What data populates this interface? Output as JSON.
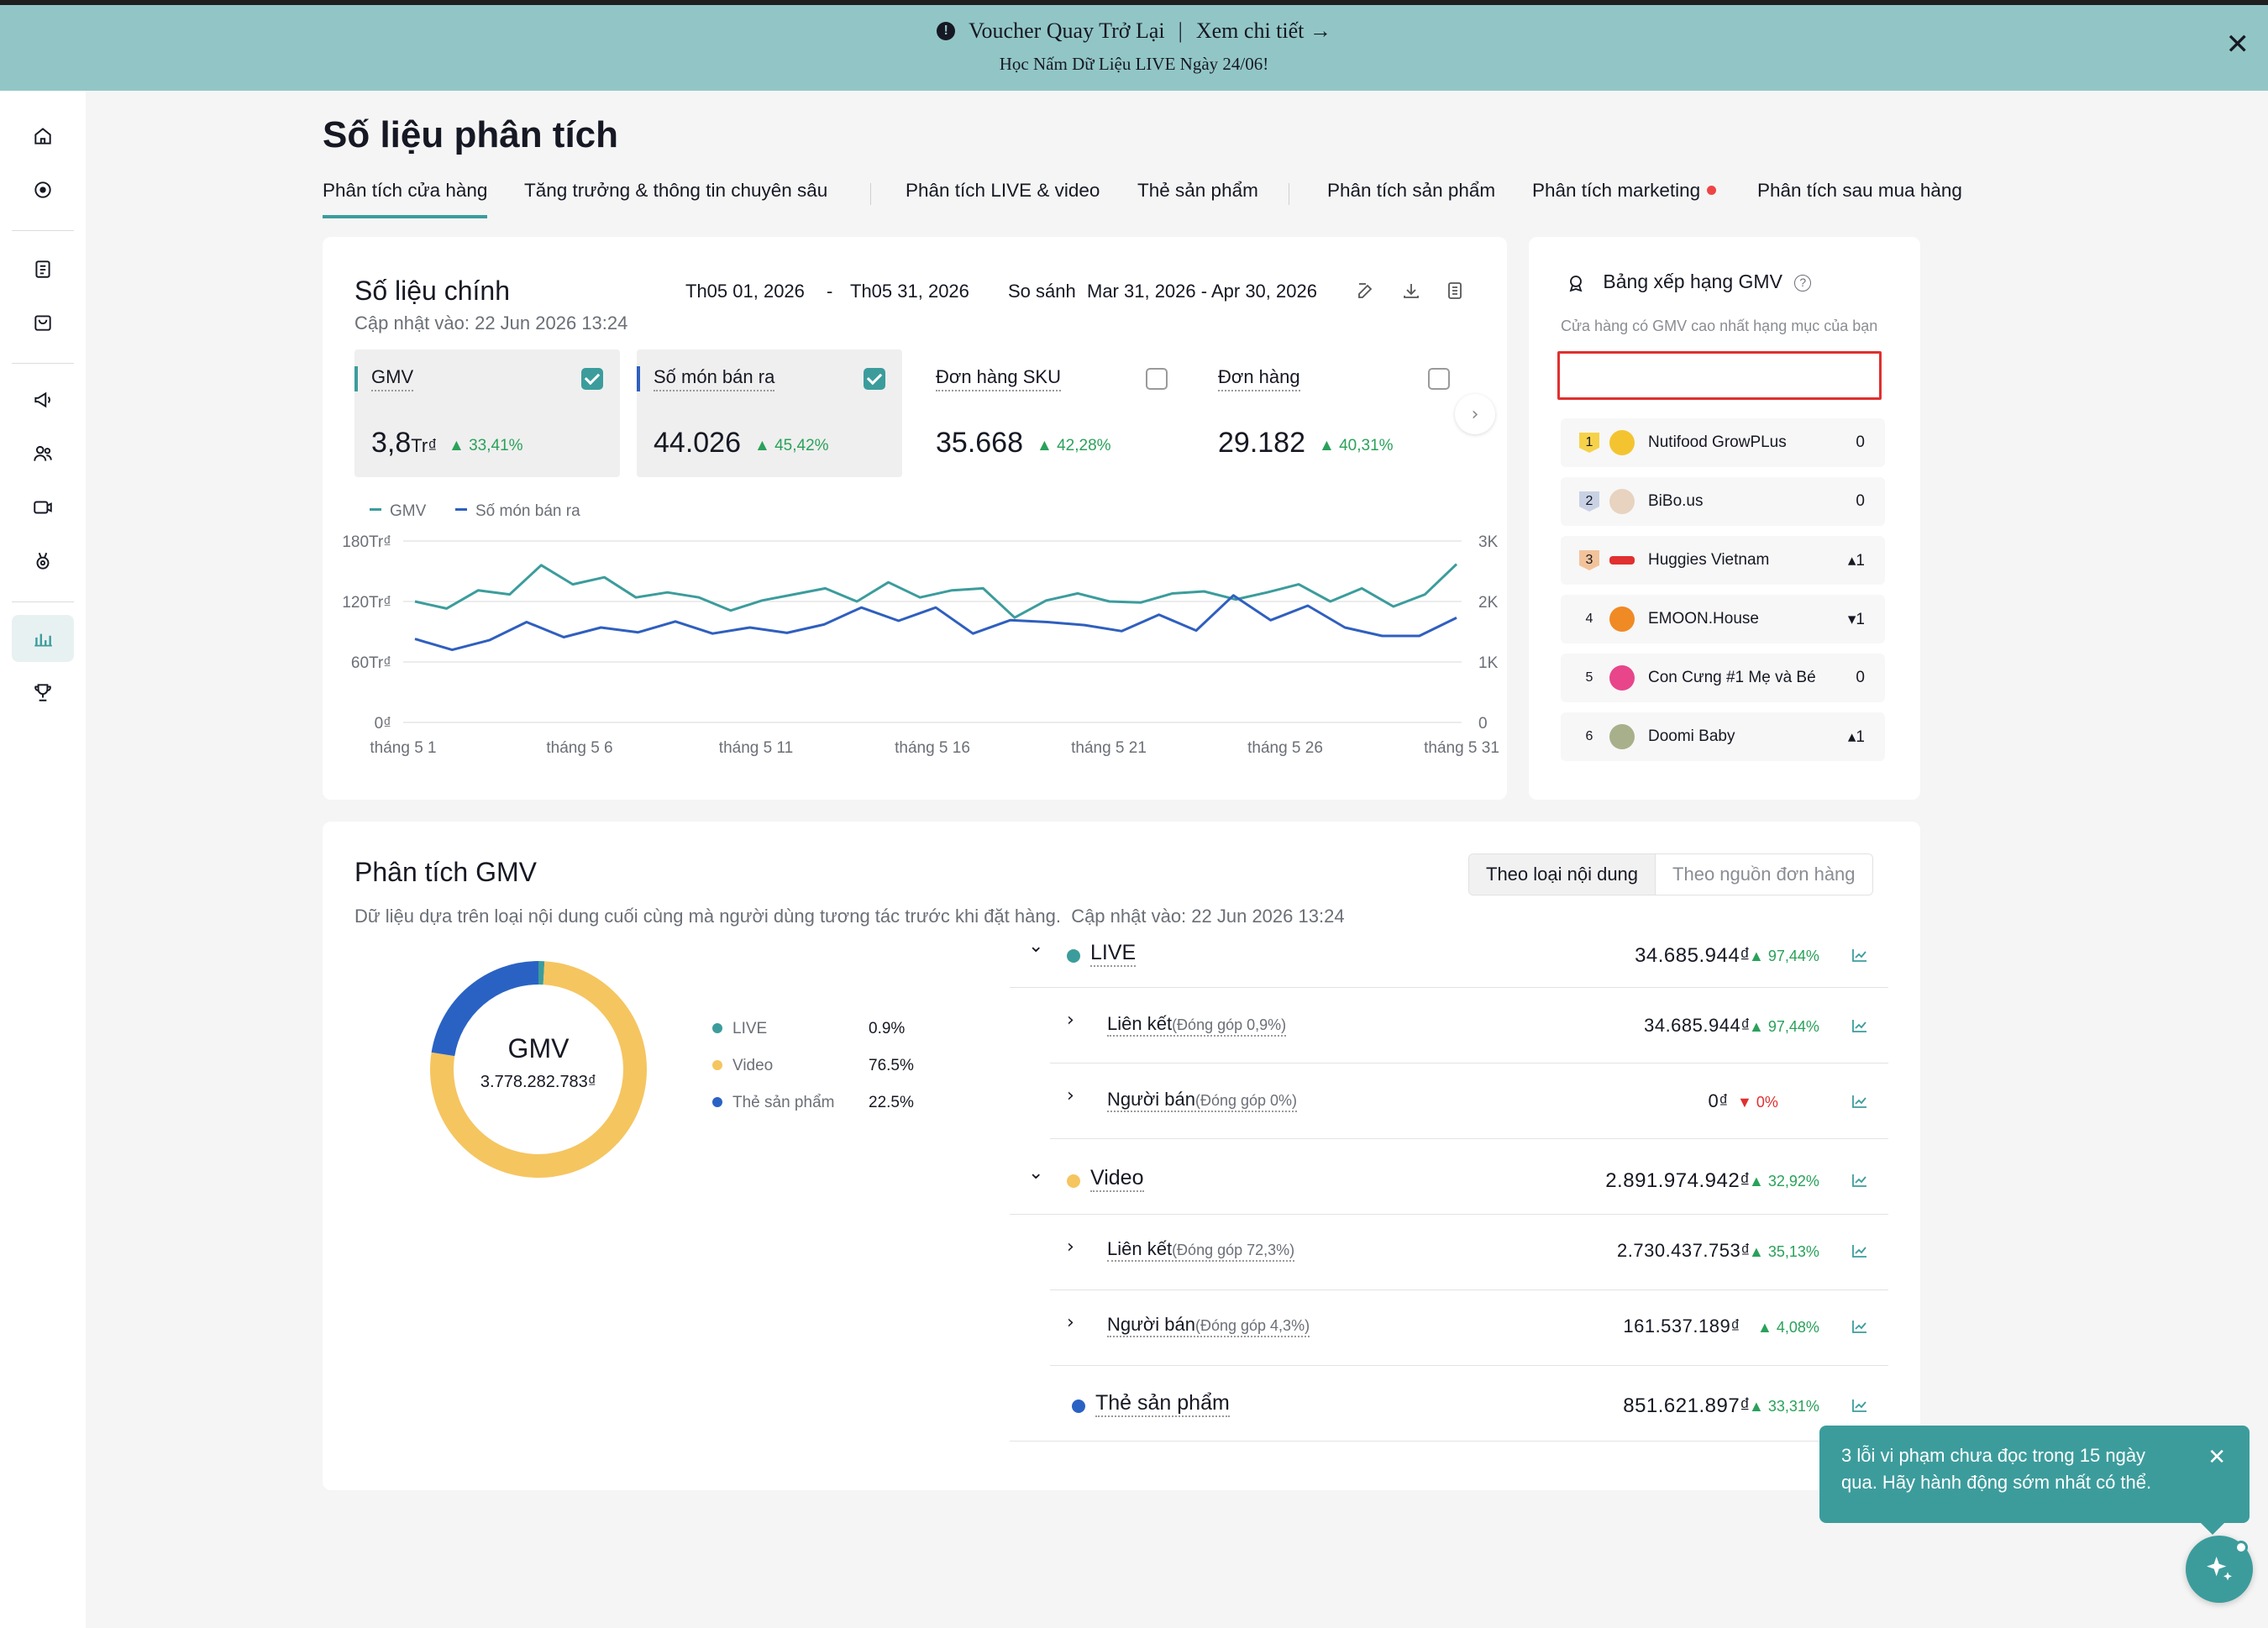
{
  "banner": {
    "voucher": "Voucher Quay Trở Lại",
    "separator": "|",
    "details_link": "Xem chi tiết →",
    "subtitle": "Học Nấm Dữ Liệu LIVE Ngày 24/06!",
    "close": "✕"
  },
  "page": {
    "title": "Số liệu phân tích"
  },
  "tabs": [
    {
      "label": "Phân tích cửa hàng"
    },
    {
      "label": "Tăng trưởng & thông tin chuyên sâu"
    },
    {
      "label": "Phân tích LIVE & video"
    },
    {
      "label": "Thẻ sản phẩm"
    },
    {
      "label": "Phân tích sản phẩm"
    },
    {
      "label": "Phân tích marketing"
    },
    {
      "label": "Phân tích sau mua hàng"
    }
  ],
  "main_metrics": {
    "title": "Số liệu chính",
    "updated": "Cập nhật vào: 22 Jun 2026 13:24",
    "date_from": "Th05 01, 2026",
    "date_dash": "-",
    "date_to": "Th05 31, 2026",
    "compare_label": "So sánh",
    "compare_range": "Mar 31, 2026 - Apr 30, 2026",
    "next": "›",
    "metrics": [
      {
        "label": "GMV",
        "value": "3,8",
        "unit": "Tr₫",
        "change": "▲ 33,41%",
        "selected": true,
        "color": "#3c9c9c"
      },
      {
        "label": "Số món bán ra",
        "value": "44.026",
        "unit": "",
        "change": "▲ 45,42%",
        "selected": true,
        "color": "#2f5fbf"
      },
      {
        "label": "Đơn hàng SKU",
        "value": "35.668",
        "unit": "",
        "change": "▲ 42,28%",
        "selected": false,
        "color": ""
      },
      {
        "label": "Đơn hàng",
        "value": "29.182",
        "unit": "",
        "change": "▲ 40,31%",
        "selected": false,
        "color": ""
      }
    ]
  },
  "chart_data": {
    "type": "line",
    "legend": [
      "GMV",
      "Số món bán ra"
    ],
    "x_tick_labels": [
      "tháng 5 1",
      "tháng 5 6",
      "tháng 5 11",
      "tháng 5 16",
      "tháng 5 21",
      "tháng 5 26",
      "tháng 5 31"
    ],
    "y_left_ticks": [
      "0₫",
      "60Tr₫",
      "120Tr₫",
      "180Tr₫"
    ],
    "y_right_ticks": [
      "0",
      "1K",
      "2K",
      "3K"
    ],
    "y_left_range": [
      0,
      180
    ],
    "y_right_range": [
      0,
      3000
    ],
    "x": [
      1,
      2,
      3,
      4,
      5,
      6,
      7,
      8,
      9,
      10,
      11,
      12,
      13,
      14,
      15,
      16,
      17,
      18,
      19,
      20,
      21,
      22,
      23,
      24,
      25,
      26,
      27,
      28,
      29,
      30,
      31
    ],
    "series": [
      {
        "name": "GMV",
        "axis": "left",
        "color": "#3c9c9c",
        "values": [
          120,
          113,
          131,
          127,
          156,
          137,
          144,
          124,
          129,
          124,
          111,
          121,
          127,
          133,
          120,
          139,
          124,
          131,
          133,
          104,
          121,
          128,
          120,
          119,
          128,
          130,
          122,
          129,
          137,
          120,
          133,
          115,
          127,
          157
        ]
      },
      {
        "name": "Số món bán ra",
        "axis": "right",
        "color": "#2f5fbf",
        "values": [
          1380,
          1200,
          1360,
          1660,
          1410,
          1570,
          1490,
          1670,
          1470,
          1570,
          1480,
          1620,
          1900,
          1680,
          1900,
          1470,
          1690,
          1660,
          1610,
          1510,
          1780,
          1520,
          2100,
          1690,
          1930,
          1570,
          1430,
          1430,
          1730
        ]
      }
    ]
  },
  "ranking": {
    "title": "Bảng xếp hạng GMV",
    "subtitle": "Cửa hàng có GMV cao nhất hạng mục của bạn",
    "rows": [
      {
        "rank": "1",
        "name": "Nutifood GrowPLus",
        "delta": "0",
        "logo_color": "#f4c430"
      },
      {
        "rank": "2",
        "name": "BiBo.us",
        "delta": "0",
        "logo_color": "#e8d3c0"
      },
      {
        "rank": "3",
        "name": "Huggies Vietnam",
        "delta": "▴1",
        "logo_color": "#e0302f"
      },
      {
        "rank": "4",
        "name": "EMOON.House",
        "delta": "▾1",
        "logo_color": "#f08a24"
      },
      {
        "rank": "5",
        "name": "Con Cưng #1 Mẹ và Bé",
        "delta": "0",
        "logo_color": "#e8458b"
      },
      {
        "rank": "6",
        "name": "Doomi Baby",
        "delta": "▴1",
        "logo_color": "#a7b08a"
      }
    ]
  },
  "gmv_analysis": {
    "title": "Phân tích GMV",
    "description": "Dữ liệu dựa trên loại nội dung cuối cùng mà người dùng tương tác trước khi đặt hàng.",
    "updated": "Cập nhật vào: 22 Jun 2026 13:24",
    "toggle": {
      "active": "Theo loại nội dung",
      "inactive": "Theo nguồn đơn hàng"
    },
    "donut": {
      "center_title": "GMV",
      "center_value": "3.778.282.783₫",
      "slices": [
        {
          "name": "LIVE",
          "pct_label": "0.9%",
          "value": 0.9,
          "color": "#3c9c9c"
        },
        {
          "name": "Video",
          "pct_label": "76.5%",
          "value": 76.5,
          "color": "#f5c560"
        },
        {
          "name": "Thẻ sản phẩm",
          "pct_label": "22.5%",
          "value": 22.5,
          "color": "#2a62c4"
        }
      ]
    },
    "rows": [
      {
        "kind": "group",
        "label": "LIVE",
        "dot": "#3c9c9c",
        "amount": "34.685.944₫",
        "change": "▲ 97,44%",
        "dir": "up",
        "chevron": "⌄"
      },
      {
        "kind": "sub",
        "label": "Liên kết",
        "note": "(Đóng góp 0,9%)",
        "amount": "34.685.944₫",
        "change": "▲ 97,44%",
        "dir": "up",
        "chevron": "›"
      },
      {
        "kind": "sub",
        "label": "Người bán",
        "note": "(Đóng góp 0%)",
        "amount": "0₫",
        "change": "▼ 0%",
        "dir": "down",
        "chevron": "›"
      },
      {
        "kind": "group",
        "label": "Video",
        "dot": "#f5c560",
        "amount": "2.891.974.942₫",
        "change": "▲ 32,92%",
        "dir": "up",
        "chevron": "⌄"
      },
      {
        "kind": "sub",
        "label": "Liên kết",
        "note": "(Đóng góp 72,3%)",
        "amount": "2.730.437.753₫",
        "change": "▲ 35,13%",
        "dir": "up",
        "chevron": "›"
      },
      {
        "kind": "sub",
        "label": "Người bán",
        "note": "(Đóng góp 4,3%)",
        "amount": "161.537.189₫",
        "change": "▲ 4,08%",
        "dir": "up",
        "chevron": "›"
      },
      {
        "kind": "group",
        "label": "Thẻ sản phẩm",
        "dot": "#2a62c4",
        "amount": "851.621.897₫",
        "change": "▲ 33,31%",
        "dir": "up",
        "chevron": ""
      }
    ]
  },
  "toast": {
    "message": "3 lỗi vi phạm chưa đọc trong 15 ngày qua. Hãy hành động sớm nhất có thể.",
    "close": "✕"
  }
}
